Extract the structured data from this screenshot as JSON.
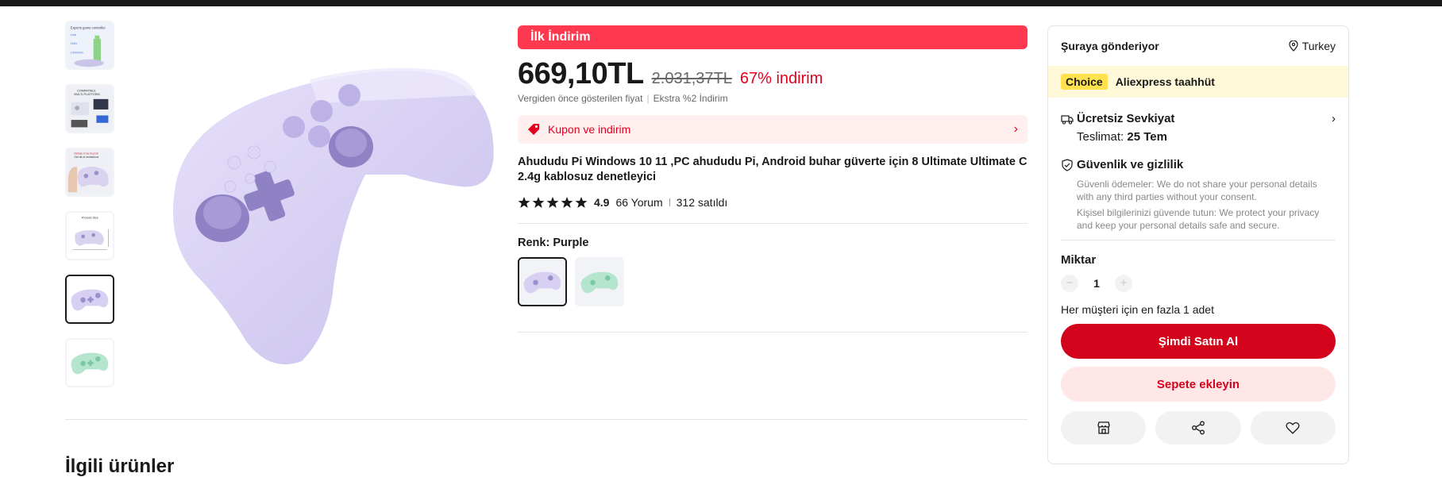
{
  "thumbnails": [
    {
      "name": "esports-controller-thumb",
      "caption": "Esports game controller"
    },
    {
      "name": "multi-platform-thumb",
      "caption": "COMPATIBLE MULTI-PLATFORM"
    },
    {
      "name": "refuse-limits-thumb",
      "caption": "Refuse to be bound! Get rid of restrictions"
    },
    {
      "name": "product-size-thumb",
      "caption": "Product Size"
    },
    {
      "name": "purple-controller-thumb",
      "caption": ""
    },
    {
      "name": "green-controller-thumb",
      "caption": ""
    }
  ],
  "product": {
    "flash_label": "İlk İndirim",
    "price": "669,10TL",
    "old_price": "2.031,37TL",
    "discount": "67% indirim",
    "price_note_1": "Vergiden önce gösterilen fiyat",
    "price_note_2": "Ekstra %2 İndirim",
    "coupon": "Kupon ve indirim",
    "title": "Ahududu Pi Windows 10 11 ,PC ahududu Pi, Android buhar güverte için 8 Ultimate Ultimate C 2.4g kablosuz denetleyici",
    "rating": "4.9",
    "reviews": "66 Yorum",
    "sold": "312 satıldı",
    "color_label": "Renk: Purple",
    "colors": [
      "Purple",
      "Green"
    ]
  },
  "panel": {
    "ship_to_label": "Şuraya gönderiyor",
    "country": "Turkey",
    "choice_badge": "Choice",
    "choice_text": "Aliexpress taahhüt",
    "shipping_title": "Ücretsiz Sevkiyat",
    "delivery_label": "Teslimat:",
    "delivery_date": "25 Tem",
    "security_title": "Güvenlik ve gizlilik",
    "security_text_1": "Güvenli ödemeler: We do not share your personal details with any third parties without your consent.",
    "security_text_2": "Kişisel bilgilerinizi güvende tutun: We protect your privacy and keep your personal details safe and secure.",
    "quantity_label": "Miktar",
    "quantity_minus": "−",
    "quantity": "1",
    "quantity_plus": "+",
    "quantity_note": "Her müşteri için en fazla 1 adet",
    "buy_now": "Şimdi Satın Al",
    "add_to_cart": "Sepete ekleyin"
  },
  "related_title": "İlgili ürünler",
  "colors": {
    "accent_red": "#fd384f",
    "buy_red": "#d3031c",
    "choice_yellow": "#ffe24d",
    "controller_purple": "#d8d0f2",
    "controller_green": "#b6e5cf"
  },
  "icons": [
    "location-pin-icon",
    "coupon-tag-icon",
    "chevron-right-icon",
    "star-icon",
    "truck-icon",
    "shield-icon",
    "store-icon",
    "share-icon",
    "heart-icon"
  ]
}
